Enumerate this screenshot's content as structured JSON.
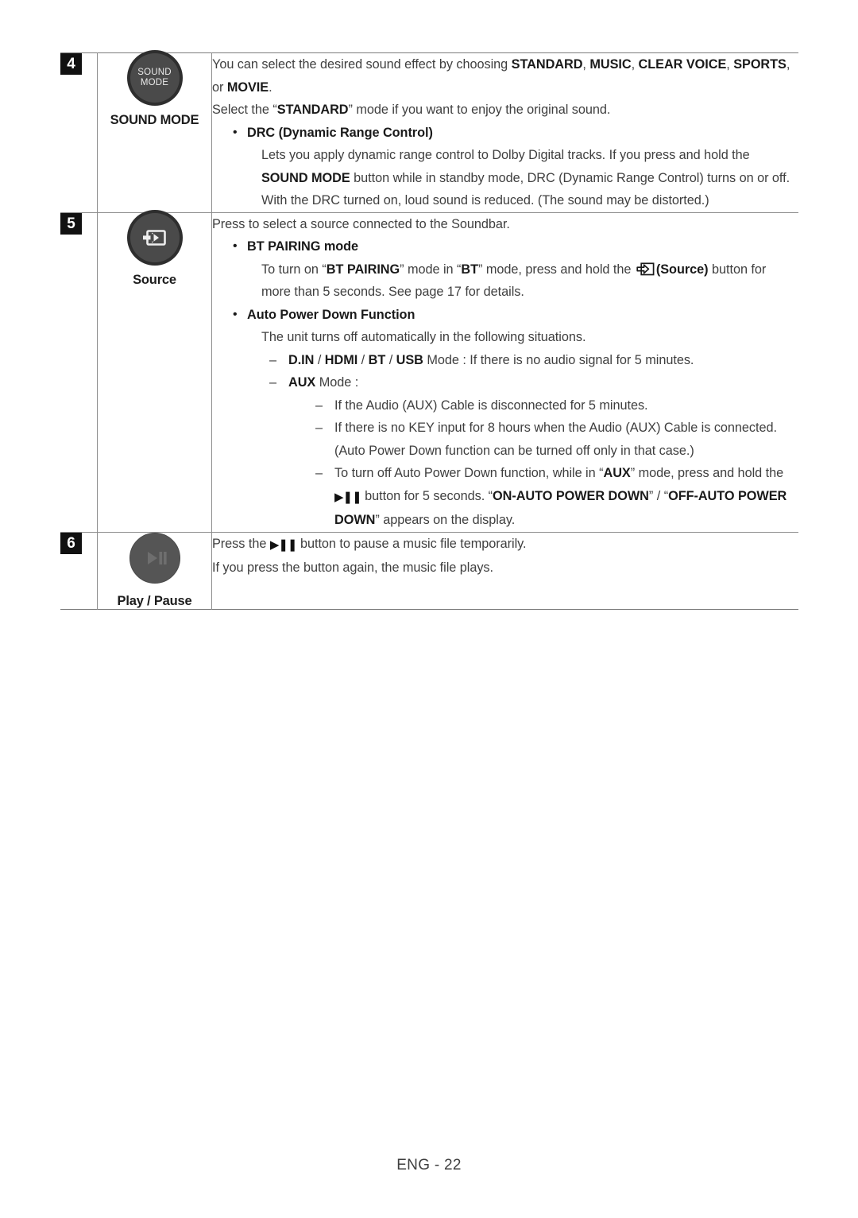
{
  "page": {
    "footer_label": "ENG - 22"
  },
  "table": {
    "rows": [
      {
        "number": "4",
        "button": {
          "icon_name": "sound-mode-button-icon",
          "face_line1": "SOUND",
          "face_line2": "MODE",
          "caption": "SOUND MODE"
        },
        "text": {
          "intro_a": "You can select the desired sound effect by choosing ",
          "mode_standard": "STANDARD",
          "sep1": ", ",
          "mode_music": "MUSIC",
          "sep2": ", ",
          "mode_clear_voice": "CLEAR VOICE",
          "sep3": ", ",
          "mode_sports": "SPORTS",
          "sep4": ", or ",
          "mode_movie": "MOVIE",
          "sep5": ".",
          "line2_a": "Select the “",
          "line2_b": "STANDARD",
          "line2_c": "” mode if you want to enjoy the original sound.",
          "bullet_drc_title": "DRC (Dynamic Range Control)",
          "drc_body_a": "Lets you apply dynamic range control to Dolby Digital tracks. If you press and hold the ",
          "drc_body_b": "SOUND MODE",
          "drc_body_c": " button while in standby mode, DRC (Dynamic Range Control) turns on or off. With the DRC turned on, loud sound is reduced. (The sound may be distorted.)"
        }
      },
      {
        "number": "5",
        "button": {
          "icon_name": "source-button-icon",
          "caption": "Source"
        },
        "text": {
          "intro": "Press to select a source connected to the Soundbar.",
          "bullet_bt_title": "BT PAIRING mode",
          "bt_body_a": "To turn on “",
          "bt_body_b": "BT PAIRING",
          "bt_body_c": "” mode in “",
          "bt_body_d": "BT",
          "bt_body_e": "” mode, press and hold the ",
          "bt_body_f": "(Source)",
          "bt_body_g": " button for more than 5 seconds. See page 17 for details.",
          "bullet_apd_title": "Auto Power Down Function",
          "apd_body": "The unit turns off automatically in the following situations.",
          "dash1_a": "D.IN",
          "dash1_sep1": " / ",
          "dash1_b": "HDMI",
          "dash1_sep2": " / ",
          "dash1_c": "BT",
          "dash1_sep3": " / ",
          "dash1_d": "USB",
          "dash1_rest": " Mode : If there is no audio signal for 5 minutes.",
          "dash2_a": "AUX",
          "dash2_rest": " Mode :",
          "sub1": "If the Audio (AUX) Cable is disconnected for 5 minutes.",
          "sub2": "If there is no KEY input for 8 hours when the Audio (AUX) Cable is connected. (Auto Power Down function can be turned off only in that case.)",
          "sub3_a": "To turn off Auto Power Down function, while in “",
          "sub3_b": "AUX",
          "sub3_c": "” mode, press and hold the ",
          "sub3_d": " button for 5 seconds. “",
          "sub3_e": "ON-AUTO POWER DOWN",
          "sub3_f": "” / “",
          "sub3_g": "OFF-AUTO POWER DOWN",
          "sub3_h": "” appears on the display."
        }
      },
      {
        "number": "6",
        "button": {
          "icon_name": "play-pause-button-icon",
          "caption": "Play / Pause"
        },
        "text": {
          "line1_a": "Press the ",
          "line1_b": " button to pause a music file temporarily.",
          "line2": "If you press the button again, the music file plays."
        }
      }
    ]
  },
  "colors": {
    "button_face": "#4a4a4a",
    "button_ring": "#2e2e2e",
    "badge_bg": "#111111",
    "rule": "#8d8d8d",
    "body_text": "#3f3f3f"
  }
}
